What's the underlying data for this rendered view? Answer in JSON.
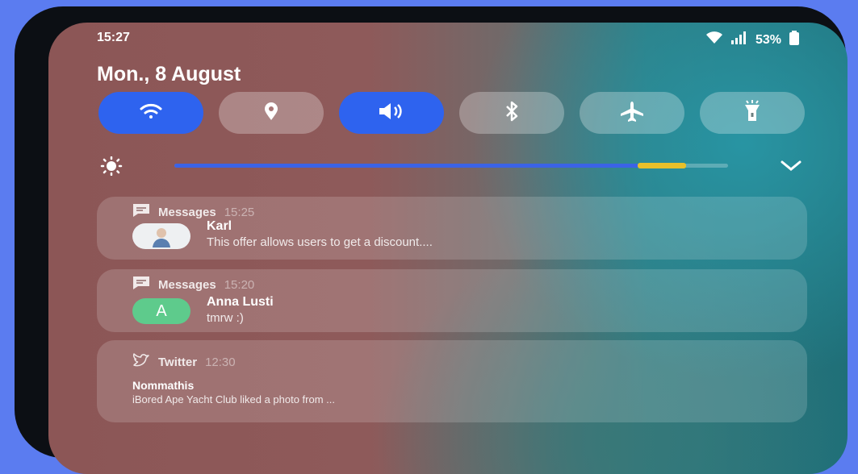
{
  "status_bar": {
    "time": "15:27",
    "battery": "53%"
  },
  "date": "Mon., 8 August",
  "quick_toggles": [
    {
      "name": "wifi",
      "icon": "wifi-icon",
      "active": true
    },
    {
      "name": "location",
      "icon": "location-pin-icon",
      "active": false
    },
    {
      "name": "sound",
      "icon": "speaker-icon",
      "active": true
    },
    {
      "name": "bluetooth",
      "icon": "bluetooth-icon",
      "active": false
    },
    {
      "name": "airplane-mode",
      "icon": "airplane-icon",
      "active": false
    },
    {
      "name": "flashlight",
      "icon": "flashlight-icon",
      "active": false
    }
  ],
  "brightness": {
    "level": 0.88,
    "icon": "sun-icon"
  },
  "notifications": [
    {
      "app": "Messages",
      "time": "15:25",
      "sender": "Karl",
      "text": "This offer allows users to get a discount....",
      "avatar": "photo"
    },
    {
      "app": "Messages",
      "time": "15:20",
      "sender": "Anna Lusti",
      "text": "tmrw :)",
      "avatar_letter": "A"
    },
    {
      "app": "Twitter",
      "time": "12:30",
      "sender": "Nommathis",
      "text": "iBored Ape Yacht Club liked a photo from ..."
    }
  ],
  "colors": {
    "accent_blue": "#2e63ef",
    "knob_yellow": "#e8c02a",
    "avatar_green": "#5ecb8c"
  }
}
